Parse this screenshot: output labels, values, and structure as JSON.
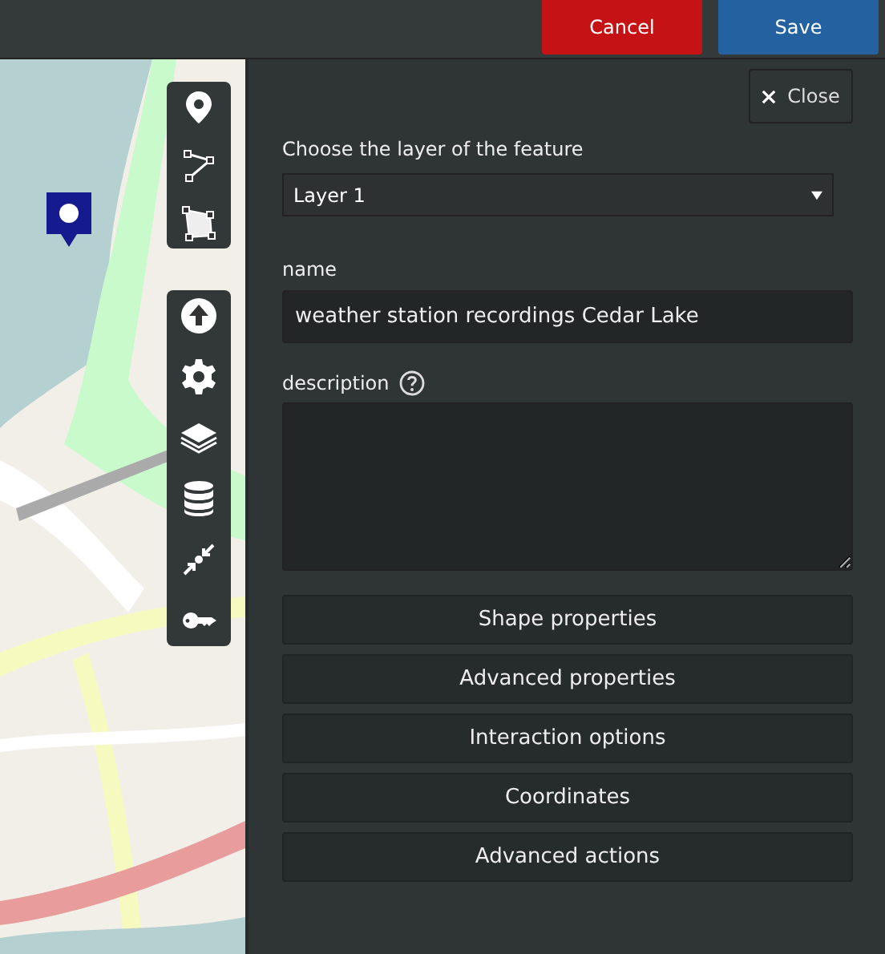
{
  "top_bar": {
    "buttons": [
      {
        "label": "Cancel",
        "kind": "danger"
      },
      {
        "label": "Save",
        "kind": "primary"
      }
    ]
  },
  "panel": {
    "close": "Close",
    "layer_label": "Choose the layer of the feature",
    "layer_value": "Layer 1",
    "name_label": "name",
    "name_value": "weather station recordings Cedar Lake",
    "description_label": "description",
    "sections": [
      "Shape properties",
      "Advanced properties",
      "Interaction options",
      "Coordinates",
      "Advanced actions"
    ]
  }
}
